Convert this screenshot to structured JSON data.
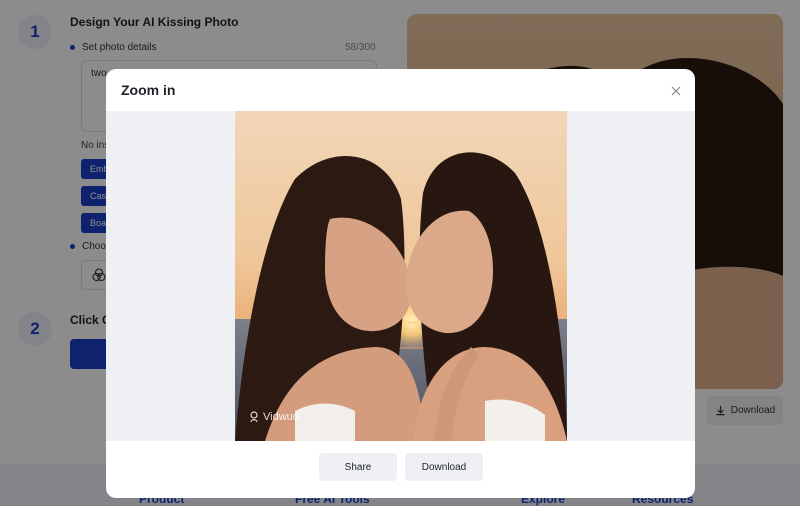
{
  "steps": [
    {
      "number": "1",
      "title": "Design Your AI Kissing Photo"
    },
    {
      "number": "2",
      "title": "Click G"
    }
  ],
  "photo_details": {
    "label": "Set photo details",
    "counter": "58/300",
    "prompt_value": "two"
  },
  "inspiration": {
    "label": "No ins",
    "chips": [
      "Emb",
      "Cas",
      "Boa"
    ]
  },
  "style": {
    "label": "Choo",
    "icon": "overlapping-circles-icon"
  },
  "preview": {
    "download_label": "Download"
  },
  "footer": {
    "links": [
      "Product",
      "Free AI Tools",
      "Explore",
      "Resources"
    ]
  },
  "modal": {
    "title": "Zoom in",
    "watermark": "Vidwud",
    "share_label": "Share",
    "download_label": "Download"
  },
  "colors": {
    "accent": "#1b3fc8",
    "overlay": "rgba(0,0,0,0.45)",
    "stage": "#eef0f4"
  }
}
